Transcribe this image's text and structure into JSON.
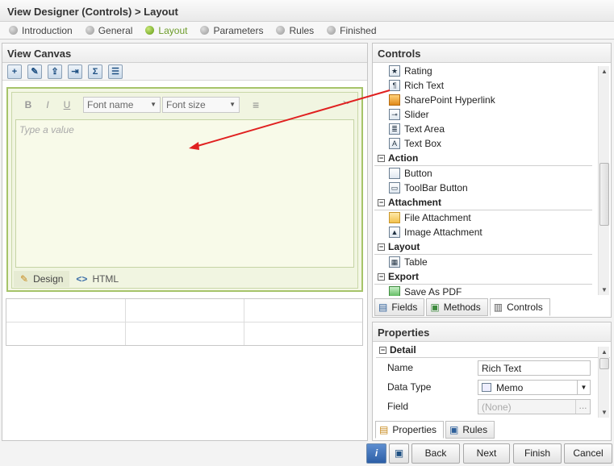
{
  "window": {
    "title": "View Designer (Controls) > Layout"
  },
  "steps": [
    {
      "label": "Introduction",
      "active": false
    },
    {
      "label": "General",
      "active": false
    },
    {
      "label": "Layout",
      "active": true
    },
    {
      "label": "Parameters",
      "active": false
    },
    {
      "label": "Rules",
      "active": false
    },
    {
      "label": "Finished",
      "active": false
    }
  ],
  "canvas": {
    "title": "View Canvas",
    "toolbar_icons": [
      "add-row-icon",
      "edit-table-icon",
      "insert-icon",
      "merge-icon",
      "sum-icon",
      "properties-icon"
    ],
    "richtext": {
      "bold": "B",
      "italic": "I",
      "underline": "U",
      "font_name": "Font name",
      "font_size": "Font size",
      "placeholder": "Type a value",
      "tab_design": "Design",
      "tab_html": "HTML"
    }
  },
  "controls": {
    "title": "Controls",
    "items_top": [
      {
        "label": "Rating",
        "icon": "star-icon"
      },
      {
        "label": "Rich Text",
        "icon": "rich-text-icon"
      },
      {
        "label": "SharePoint Hyperlink",
        "icon": "sharepoint-hyperlink-icon"
      },
      {
        "label": "Slider",
        "icon": "slider-icon"
      },
      {
        "label": "Text Area",
        "icon": "text-area-icon"
      },
      {
        "label": "Text Box",
        "icon": "text-box-icon"
      }
    ],
    "groups": [
      {
        "label": "Action",
        "items": [
          {
            "label": "Button",
            "icon": "button-icon"
          },
          {
            "label": "ToolBar Button",
            "icon": "toolbar-button-icon"
          }
        ]
      },
      {
        "label": "Attachment",
        "items": [
          {
            "label": "File Attachment",
            "icon": "folder-icon"
          },
          {
            "label": "Image Attachment",
            "icon": "image-icon"
          }
        ]
      },
      {
        "label": "Layout",
        "items": [
          {
            "label": "Table",
            "icon": "table-icon"
          }
        ]
      },
      {
        "label": "Export",
        "items": [
          {
            "label": "Save As PDF",
            "icon": "pdf-icon"
          }
        ]
      }
    ],
    "tabs": [
      "Fields",
      "Methods",
      "Controls"
    ]
  },
  "properties": {
    "title": "Properties",
    "section": "Detail",
    "rows": [
      {
        "label": "Name",
        "value": "Rich Text"
      },
      {
        "label": "Data Type",
        "value": "Memo"
      },
      {
        "label": "Field",
        "value": "(None)"
      }
    ],
    "field_button": "...",
    "tabs": [
      "Properties",
      "Rules"
    ]
  },
  "footer": {
    "back": "Back",
    "next": "Next",
    "finish": "Finish",
    "cancel": "Cancel"
  }
}
